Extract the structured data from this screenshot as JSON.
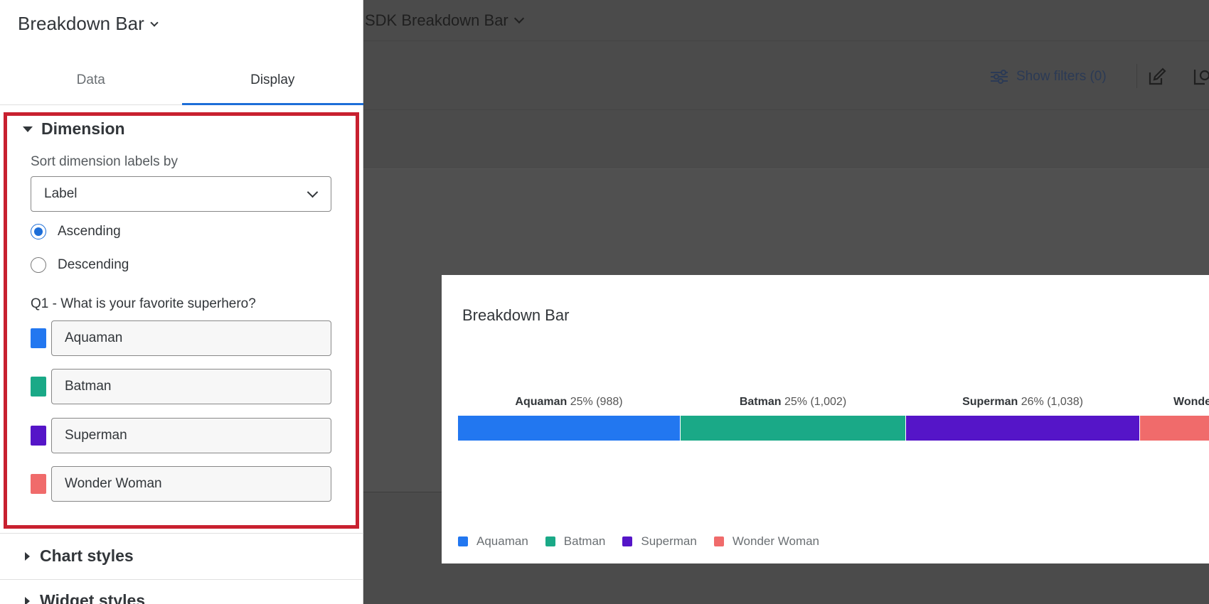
{
  "panel": {
    "title": "Breakdown Bar",
    "tabs": [
      {
        "label": "Data",
        "active": false
      },
      {
        "label": "Display",
        "active": true
      }
    ],
    "dimension_section": {
      "title": "Dimension",
      "sort_label": "Sort dimension labels by",
      "sort_value": "Label",
      "radios": [
        {
          "label": "Ascending",
          "checked": true
        },
        {
          "label": "Descending",
          "checked": false
        }
      ],
      "question_label": "Q1 - What is your favorite superhero?",
      "choices": [
        {
          "label": "Aquaman",
          "color": "#2277f0"
        },
        {
          "label": "Batman",
          "color": "#1aa987"
        },
        {
          "label": "Superman",
          "color": "#5515c8"
        },
        {
          "label": "Wonder Woman",
          "color": "#f06b6b"
        }
      ]
    },
    "chart_styles_title": "Chart styles",
    "widget_styles_title": "Widget styles"
  },
  "background": {
    "dashboard_title": "SDK Breakdown Bar",
    "show_filters_label": "Show filters (0)"
  },
  "widget": {
    "title": "Breakdown Bar"
  },
  "chart_data": {
    "type": "bar",
    "orientation": "horizontal-stacked",
    "title": "Breakdown Bar",
    "categories": [
      "Aquaman",
      "Batman",
      "Superman",
      "Wonder Woman"
    ],
    "values": [
      988,
      1002,
      1038,
      null
    ],
    "percents": [
      25,
      25,
      26,
      null
    ],
    "value_labels": [
      "25% (988)",
      "25% (1,002)",
      "26% (1,038)",
      ""
    ],
    "segment_labels": [
      "Aquaman",
      "Batman",
      "Superman",
      "Wonde"
    ],
    "colors": [
      "#2277f0",
      "#1aa987",
      "#5515c8",
      "#f06b6b"
    ],
    "legend": [
      "Aquaman",
      "Batman",
      "Superman",
      "Wonder Woman"
    ],
    "legend_position": "bottom-left"
  }
}
